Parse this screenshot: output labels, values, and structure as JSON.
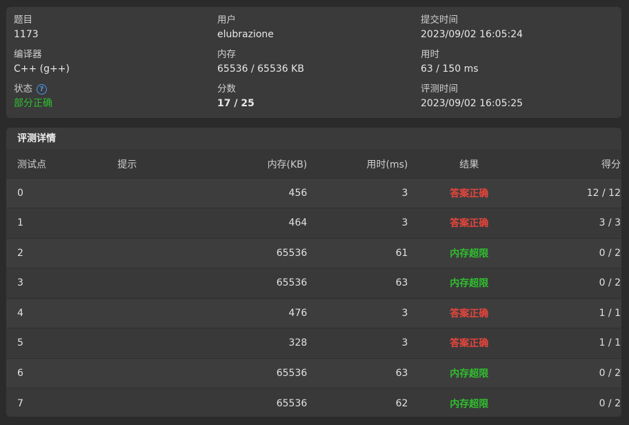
{
  "info": {
    "problem_label": "题目",
    "problem_value": "1173",
    "user_label": "用户",
    "user_value": "elubrazione",
    "submit_time_label": "提交时间",
    "submit_time_value": "2023/09/02 16:05:24",
    "compiler_label": "编译器",
    "compiler_value": "C++ (g++)",
    "memory_label": "内存",
    "memory_value": "65536 / 65536 KB",
    "time_used_label": "用时",
    "time_used_value": "63 / 150 ms",
    "status_label": "状态",
    "status_value": "部分正确",
    "score_label": "分数",
    "score_value": "17 / 25",
    "judge_time_label": "评测时间",
    "judge_time_value": "2023/09/02 16:05:25"
  },
  "detail": {
    "title": "评测详情",
    "headers": {
      "case": "测试点",
      "hint": "提示",
      "memory": "内存(KB)",
      "time": "用时(ms)",
      "result": "结果",
      "score": "得分"
    },
    "rows": [
      {
        "case": "0",
        "hint": "",
        "memory": "456",
        "time": "3",
        "result": "答案正确",
        "score": "12 / 12"
      },
      {
        "case": "1",
        "hint": "",
        "memory": "464",
        "time": "3",
        "result": "答案正确",
        "score": "3 / 3"
      },
      {
        "case": "2",
        "hint": "",
        "memory": "65536",
        "time": "61",
        "result": "内存超限",
        "score": "0 / 2"
      },
      {
        "case": "3",
        "hint": "",
        "memory": "65536",
        "time": "63",
        "result": "内存超限",
        "score": "0 / 2"
      },
      {
        "case": "4",
        "hint": "",
        "memory": "476",
        "time": "3",
        "result": "答案正确",
        "score": "1 / 1"
      },
      {
        "case": "5",
        "hint": "",
        "memory": "328",
        "time": "3",
        "result": "答案正确",
        "score": "1 / 1"
      },
      {
        "case": "6",
        "hint": "",
        "memory": "65536",
        "time": "63",
        "result": "内存超限",
        "score": "0 / 2"
      },
      {
        "case": "7",
        "hint": "",
        "memory": "65536",
        "time": "62",
        "result": "内存超限",
        "score": "0 / 2"
      }
    ]
  },
  "colors": {
    "accepted": "#e8453c",
    "memory_exceeded": "#2fbf2f",
    "status_partial": "#2fbf2f",
    "help_icon": "#4a9cf0"
  },
  "icons": {
    "status_help": "question-circle-icon"
  }
}
